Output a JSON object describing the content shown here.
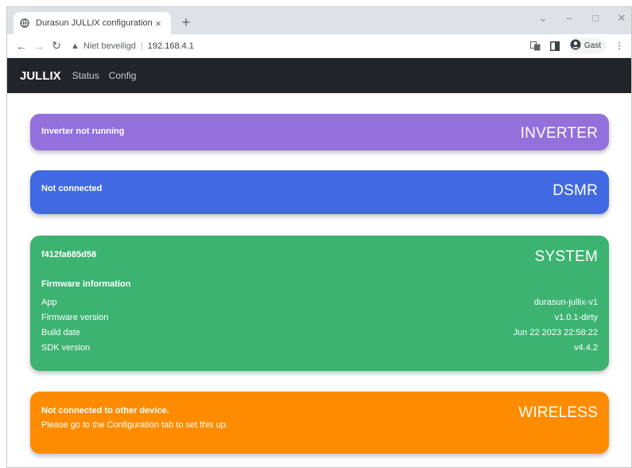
{
  "browser": {
    "tab_title": "Durasun JULLIX configuration",
    "tab_close": "×",
    "new_tab": "+",
    "security_label": "Niet beveiligd",
    "url": "192.168.4.1",
    "profile_label": "Gast"
  },
  "navbar": {
    "brand": "JULLIX",
    "links": [
      "Status",
      "Config"
    ]
  },
  "colors": {
    "inverter": "#9370db",
    "dsmr": "#4169e1",
    "system": "#3cb371",
    "wireless": "#ff8c00"
  },
  "cards": {
    "inverter": {
      "title": "INVERTER",
      "status": "Inverter not running"
    },
    "dsmr": {
      "title": "DSMR",
      "status": "Not connected"
    },
    "system": {
      "title": "SYSTEM",
      "device_id": "f412fa685d58",
      "section_heading": "Firmware information",
      "rows": [
        {
          "label": "App",
          "value": "durasun-jullix-v1"
        },
        {
          "label": "Firmware version",
          "value": "v1.0.1-dirty"
        },
        {
          "label": "Build date",
          "value": "Jun 22 2023 22:58:22"
        },
        {
          "label": "SDK version",
          "value": "v4.4.2"
        }
      ]
    },
    "wireless": {
      "title": "WIRELESS",
      "status": "Not connected to other device.",
      "hint": "Please go to the Configuration tab to set this up."
    }
  }
}
